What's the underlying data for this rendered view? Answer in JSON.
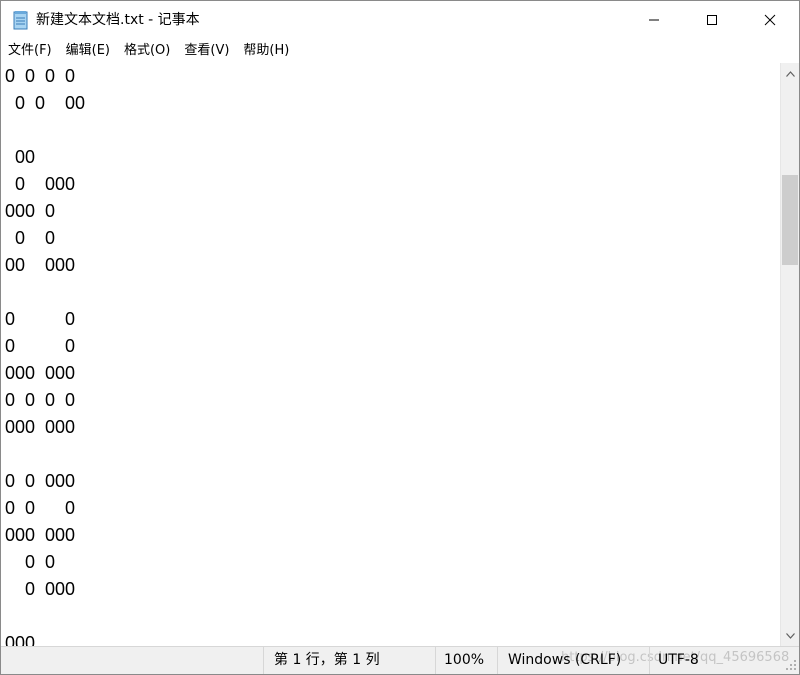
{
  "window": {
    "title": "新建文本文档.txt - 记事本",
    "app_icon": "notepad-icon",
    "minimize_icon": "minimize-icon",
    "maximize_icon": "maximize-icon",
    "close_icon": "close-icon"
  },
  "menu": {
    "items": [
      {
        "label": "文件(F)"
      },
      {
        "label": "编辑(E)"
      },
      {
        "label": "格式(O)"
      },
      {
        "label": "查看(V)"
      },
      {
        "label": "帮助(H)"
      }
    ]
  },
  "editor": {
    "content": "0  0  0  0\n  0  0    00\n\n  00\n  0    000\n000  0\n  0    0\n00    000\n\n0          0\n0          0\n000  000\n0  0  0  0\n000  000\n\n0  0  000\n0  0      0\n000  000\n    0  0\n    0  000\n\n000"
  },
  "scrollbar": {
    "up_icon": "scroll-up-arrow-icon",
    "down_icon": "scroll-down-arrow-icon"
  },
  "status": {
    "position": "第 1 行，第 1 列",
    "zoom": "100%",
    "line_ending": "Windows (CRLF)",
    "encoding": "UTF-8",
    "watermark": "https://blog.csdn.net/qq_45696568"
  },
  "colors": {
    "background": "#ffffff",
    "statusbar": "#f0f0f0",
    "scroll_thumb": "#cdcdcd"
  }
}
